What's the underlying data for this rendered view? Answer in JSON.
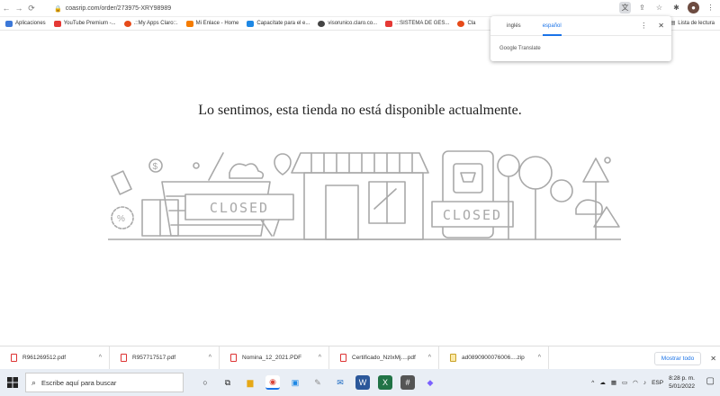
{
  "browser": {
    "url": "coasrip.com/order/273975-XRY98989",
    "bookmarks": [
      {
        "label": "Aplicaciones",
        "color": "#3c78d8"
      },
      {
        "label": "YouTube Premium -...",
        "color": "#e53935"
      },
      {
        "label": ".::My Apps Claro::.",
        "color": "#e64a19"
      },
      {
        "label": "Mi Enlace - Home",
        "color": "#f57c00"
      },
      {
        "label": "Capacítate para el e...",
        "color": "#1e88e5"
      },
      {
        "label": "visorunico.claro.co...",
        "color": "#444444"
      },
      {
        "label": ".::SISTEMA DE GES...",
        "color": "#e53935"
      },
      {
        "label": "Cla",
        "color": "#e64a19"
      }
    ],
    "reading_list": "Lista de lectura"
  },
  "translate_popup": {
    "tab_source": "inglés",
    "tab_target": "español",
    "brand": "Google Translate"
  },
  "page": {
    "message": "Lo sentimos, esta tienda no está disponible actualmente.",
    "sign_left": "CLOSED",
    "sign_right": "CLOSED"
  },
  "downloads": {
    "items": [
      {
        "name": "R961269512.pdf",
        "type": "pdf"
      },
      {
        "name": "R957717517.pdf",
        "type": "pdf"
      },
      {
        "name": "Nomina_12_2021.PDF",
        "type": "pdf"
      },
      {
        "name": "Certificado_NzIxMj....pdf",
        "type": "pdf"
      },
      {
        "name": "ad0890900076006....zip",
        "type": "zip"
      }
    ],
    "show_all": "Mostrar todo"
  },
  "taskbar": {
    "search_placeholder": "Escribe aquí para buscar",
    "lang": "ESP",
    "time": "8:28 p. m.",
    "date": "5/01/2022"
  }
}
